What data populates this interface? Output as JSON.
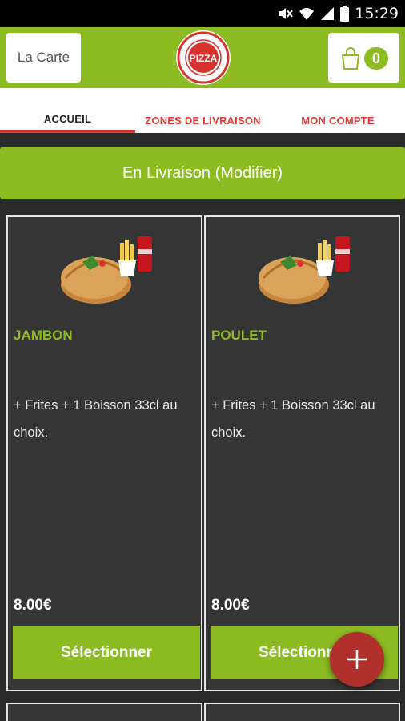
{
  "status_bar": {
    "time": "15:29"
  },
  "header": {
    "carte_label": "La Carte",
    "logo_text": "PIZZA",
    "cart_count": "0"
  },
  "tabs": [
    {
      "label": "ACCUEIL",
      "active": true
    },
    {
      "label": "ZONES DE LIVRAISON",
      "active": false
    },
    {
      "label": "MON COMPTE",
      "active": false
    }
  ],
  "delivery": {
    "label": "En Livraison (Modifier)"
  },
  "products": [
    {
      "title": "JAMBON",
      "description": "+ Frites + 1 Boisson 33cl au choix.",
      "price": "8.00€",
      "button_label": "Sélectionner"
    },
    {
      "title": "POULET",
      "description": "+ Frites + 1 Boisson 33cl au choix.",
      "price": "8.00€",
      "button_label": "Sélectionner"
    }
  ],
  "colors": {
    "accent_green": "#8dbb22",
    "tab_red": "#e53935",
    "fab_red": "#b0312b",
    "card_bg": "#353535",
    "page_bg": "#2b2b2b"
  },
  "icons": [
    "mute-icon",
    "wifi-icon",
    "signal-icon",
    "battery-icon",
    "shopping-bag-icon",
    "plus-icon"
  ]
}
